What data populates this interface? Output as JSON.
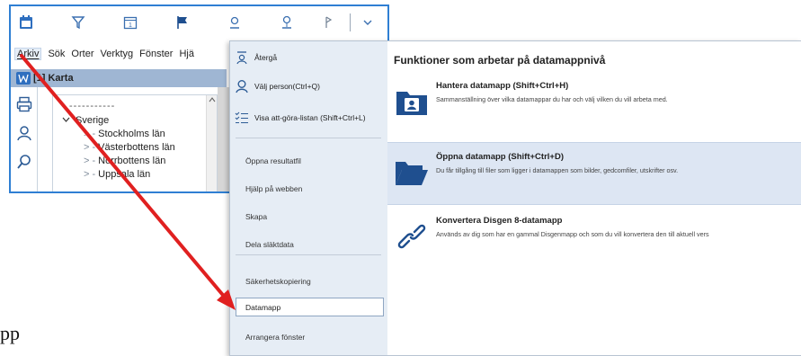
{
  "menubar": {
    "items": [
      "Arkiv",
      "Sök",
      "Orter",
      "Verktyg",
      "Fönster",
      "Hjä"
    ]
  },
  "toolbar_icons": [
    "calendar-book-icon",
    "filter-icon",
    "calendar-icon",
    "flag-icon",
    "person-pin-icon",
    "map-pin-icon",
    "pin-icon",
    "dropdown-icon"
  ],
  "map_window": {
    "title_prefix": "[1]",
    "title": "Karta",
    "tree_dashes": "-----------",
    "tree_root": "Sverige",
    "tree_items": [
      "Stockholms län",
      "Västerbottens län",
      "Norrbottens län",
      "Uppsala län"
    ]
  },
  "backstage": {
    "left_items": [
      {
        "label": "Återgå",
        "icon": "back-arrow-icon"
      },
      {
        "label": "Välj person(Ctrl+Q)",
        "icon": "person-icon"
      },
      {
        "label": "Visa att-göra-listan (Shift+Ctrl+L)",
        "icon": "checklist-icon"
      }
    ],
    "plain_items": [
      "Öppna resultatfil",
      "Hjälp på webben",
      "Skapa",
      "Dela släktdata"
    ],
    "lower_items": [
      "Säkerhetskopiering"
    ],
    "highlighted_item": "Datamapp",
    "last_item": "Arrangera fönster",
    "heading": "Funktioner som arbetar på datamappnivå",
    "functions": [
      {
        "title": "Hantera datamapp (Shift+Ctrl+H)",
        "description": "Sammanställning över vilka datamappar du har och välj vilken du vill arbeta med.",
        "icon": "folder-person-icon",
        "selected": false
      },
      {
        "title": "Öppna datamapp (Shift+Ctrl+D)",
        "description": "Du får tillgång till filer som ligger i datamappen som bilder, gedcomfiler, utskrifter osv.",
        "icon": "open-folder-icon",
        "selected": true
      },
      {
        "title": "Konvertera Disgen 8-datamapp",
        "description": "Används av dig som har en gammal Disgenmapp och som du vill konvertera den till aktuell vers",
        "icon": "link-icon",
        "selected": false
      }
    ]
  },
  "edge_text": "pp",
  "colors": {
    "window_border": "#2f7fd3",
    "title_bar": "#9fb6d3",
    "backstage_left": "#e6edf5",
    "selection": "#dde6f3",
    "arrow": "#e02020"
  }
}
